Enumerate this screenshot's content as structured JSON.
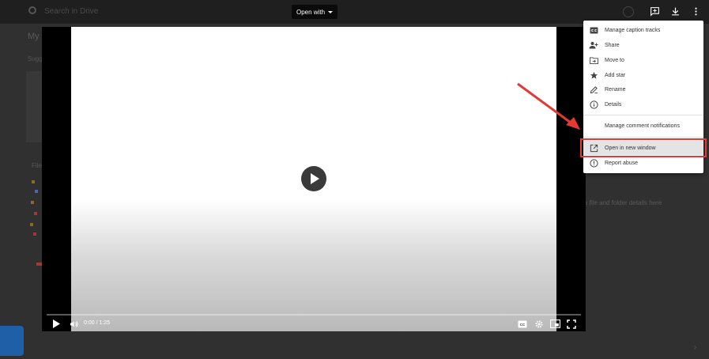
{
  "toolbar": {
    "open_with_label": "Open with",
    "search_ghost": "Search in Drive"
  },
  "background": {
    "title": "My",
    "suggested": "Sugg",
    "files": "File",
    "side_text": "ve file and folder details here"
  },
  "player": {
    "time": "0:00 / 1:25"
  },
  "menu": {
    "items": [
      {
        "label": "Manage caption tracks",
        "icon": "closed-caption-icon"
      },
      {
        "label": "Share",
        "icon": "add-person-icon"
      },
      {
        "label": "Move to",
        "icon": "move-folder-icon"
      },
      {
        "label": "Add star",
        "icon": "star-icon"
      },
      {
        "label": "Rename",
        "icon": "pencil-icon"
      },
      {
        "label": "Details",
        "icon": "info-icon"
      },
      {
        "label": "Manage comment notifications",
        "icon": ""
      },
      {
        "label": "Open in new window",
        "icon": "open-in-new-icon"
      },
      {
        "label": "Report abuse",
        "icon": "report-icon"
      }
    ],
    "highlighted_item": "Open in new window"
  },
  "colors": {
    "highlight_box": "#e53935",
    "annotation_arrow": "#e53935",
    "menu_bg": "#ffffff",
    "overlay": "#2b2b2b"
  }
}
